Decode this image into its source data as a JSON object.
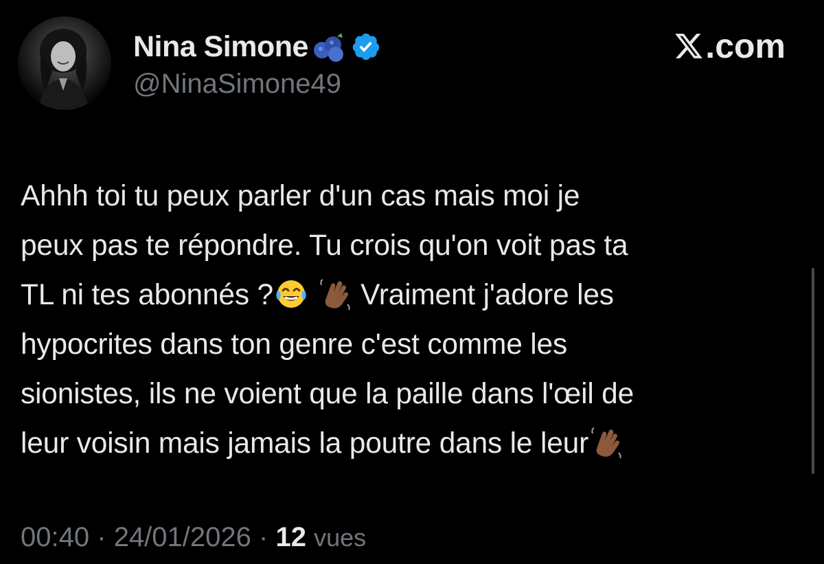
{
  "author": {
    "display_name": "Nina Simone",
    "handle": "@NinaSimone49",
    "name_emoji": "blueberries-emoji",
    "verified_icon": "verified-badge-icon",
    "verified_color": "#1d9bf0"
  },
  "brand": {
    "label": ".com",
    "logo": "x-logo-icon"
  },
  "tweet": {
    "lines": [
      "Ahhh toi tu peux parler d'un cas mais moi je",
      "peux pas te répondre. Tu crois qu'on voit pas ta",
      "TL ni tes abonnés ?",
      "Vraiment j'adore les",
      "hypocrites dans ton genre c'est comme les",
      "sionistes, ils ne voient que la paille dans l'œil de",
      "leur voisin mais jamais la poutre dans le leur"
    ],
    "emojis": [
      "tears-of-joy-emoji",
      "waving-hand-emoji"
    ]
  },
  "meta": {
    "time": "00:40",
    "separator": "·",
    "date": "24/01/2026",
    "views_count": "12",
    "views_label": "vues"
  },
  "colors": {
    "background": "#000000",
    "text": "#e7e9ea",
    "secondary": "#71767b"
  }
}
